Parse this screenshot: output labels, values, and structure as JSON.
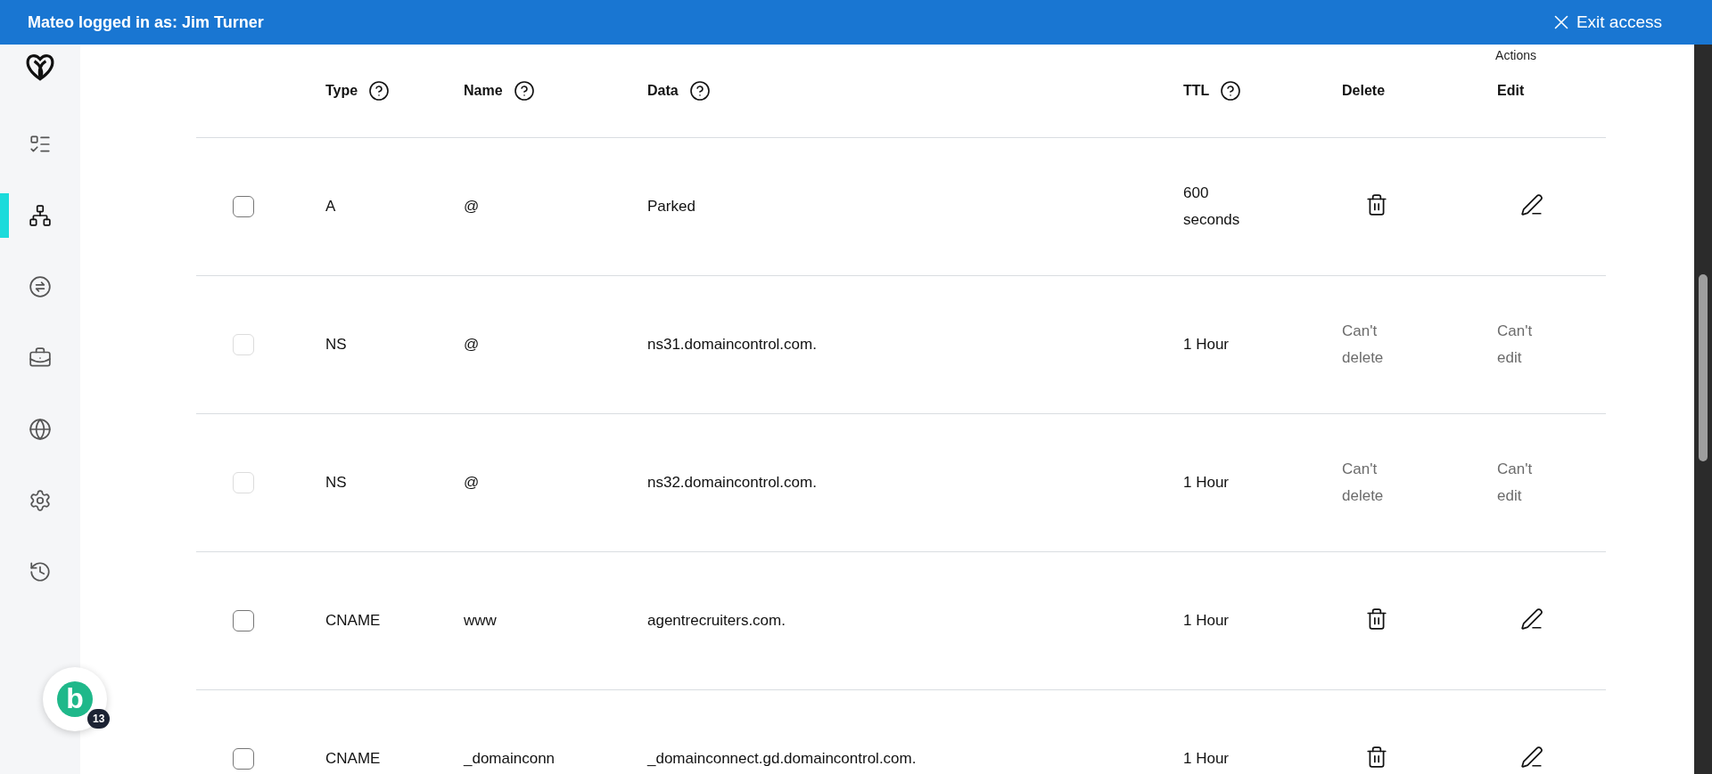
{
  "banner": {
    "title": "Mateo logged in as: Jim Turner",
    "exit_label": "Exit access"
  },
  "sidebar": {
    "items": [
      {
        "kind": "list",
        "selected": false
      },
      {
        "kind": "sitemap",
        "selected": true
      },
      {
        "kind": "exchange",
        "selected": false
      },
      {
        "kind": "briefcase",
        "selected": false
      },
      {
        "kind": "globe",
        "selected": false
      },
      {
        "kind": "gear",
        "selected": false
      },
      {
        "kind": "history",
        "selected": false
      }
    ]
  },
  "chat_bubble": {
    "letter": "b",
    "count": "13"
  },
  "table": {
    "actions_label": "Actions",
    "columns": [
      {
        "label": "Type",
        "help": true
      },
      {
        "label": "Name",
        "help": true
      },
      {
        "label": "Data",
        "help": true
      },
      {
        "label": "TTL",
        "help": true
      },
      {
        "label": "Delete",
        "help": false
      },
      {
        "label": "Edit",
        "help": false
      }
    ],
    "rows": [
      {
        "disabled": false,
        "type": "A",
        "name": "@",
        "data": "Parked",
        "ttl": "600 seconds",
        "can_delete": true,
        "can_edit": true
      },
      {
        "disabled": true,
        "type": "NS",
        "name": "@",
        "data": "ns31.domaincontrol.com.",
        "ttl": "1 Hour",
        "can_delete": false,
        "delete_text": "Can't delete",
        "can_edit": false,
        "edit_text": "Can't edit"
      },
      {
        "disabled": true,
        "type": "NS",
        "name": "@",
        "data": "ns32.domaincontrol.com.",
        "ttl": "1 Hour",
        "can_delete": false,
        "delete_text": "Can't delete",
        "can_edit": false,
        "edit_text": "Can't edit"
      },
      {
        "disabled": false,
        "type": "CNAME",
        "name": "www",
        "data": "agentrecruiters.com.",
        "ttl": "1 Hour",
        "can_delete": true,
        "can_edit": true
      },
      {
        "disabled": false,
        "type": "CNAME",
        "name": "_domainconn",
        "data": "_domainconnect.gd.domaincontrol.com.",
        "ttl": "1 Hour",
        "can_delete": true,
        "can_edit": true
      }
    ]
  }
}
